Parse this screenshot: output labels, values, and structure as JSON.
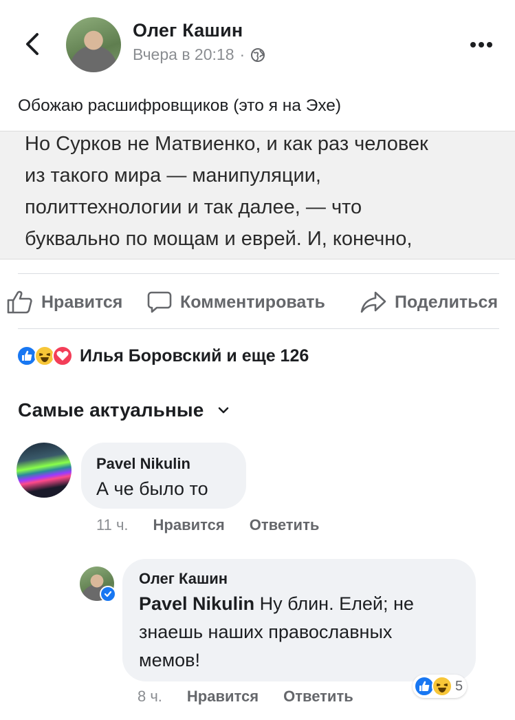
{
  "header": {
    "author": "Олег Кашин",
    "time": "Вчера в 20:18",
    "separator": "·",
    "icons": {
      "back": "chevron-left-icon",
      "privacy": "globe-icon",
      "more": "more-dots-icon"
    }
  },
  "post": {
    "text": "Обожаю расшифровщиков (это я на Эхе)",
    "quote_lines": [
      "Но Сурков не Матвиенко, и как раз человек",
      "из такого мира — манипуляции,",
      "политтехнологии и так далее, — что",
      "буквально по мощам и еврей. И, конечно,"
    ]
  },
  "actions": {
    "like": "Нравится",
    "comment": "Комментировать",
    "share": "Поделиться"
  },
  "reactions": {
    "summary": "Илья Боровский и еще 126",
    "types": [
      "like",
      "haha",
      "love"
    ],
    "colors": {
      "like": "#1877f2",
      "haha": "#f7c638",
      "love": "#f33e58"
    }
  },
  "sort": {
    "label": "Самые актуальные"
  },
  "comments": [
    {
      "author": "Pavel Nikulin",
      "text": "А че было то",
      "time": "11 ч.",
      "like": "Нравится",
      "reply": "Ответить"
    }
  ],
  "replies": [
    {
      "author": "Олег Кашин",
      "mention": "Pavel Nikulin",
      "text_line1": "Ну блин. Елей; не",
      "text_line2": "знаешь наших православных",
      "text_line3": "мемов!",
      "time": "8 ч.",
      "like": "Нравится",
      "reply": "Ответить",
      "reaction_count": "5"
    }
  ]
}
